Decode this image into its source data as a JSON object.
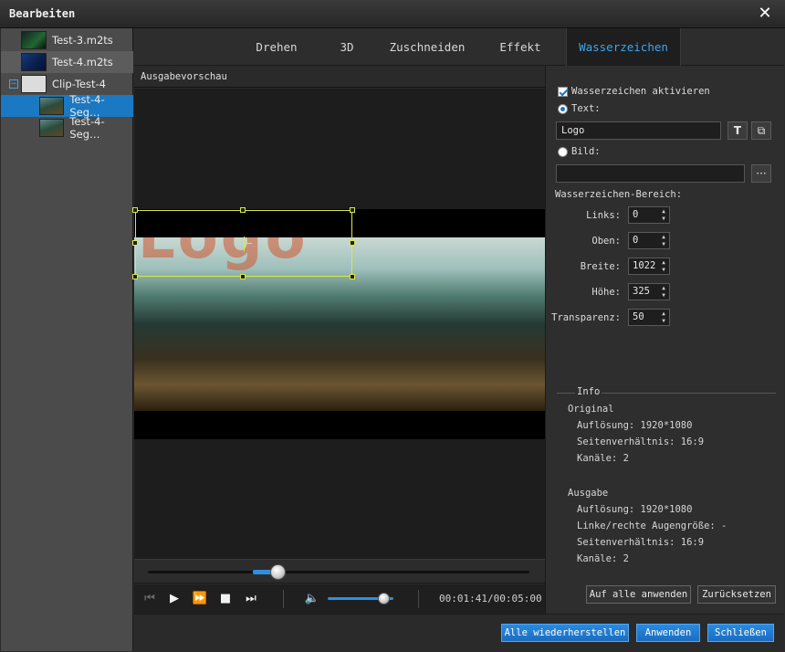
{
  "window": {
    "title": "Bearbeiten",
    "close_glyph": "✕"
  },
  "sidebar": {
    "items": [
      {
        "label": "Test-3.m2ts"
      },
      {
        "label": "Test-4.m2ts"
      },
      {
        "label": "Clip-Test-4",
        "expander": "−"
      },
      {
        "label": "Test-4-Seg…"
      },
      {
        "label": "Test-4-Seg…"
      }
    ]
  },
  "tabs": [
    {
      "label": "Drehen"
    },
    {
      "label": "3D"
    },
    {
      "label": "Zuschneiden"
    },
    {
      "label": "Effekt"
    },
    {
      "label": "Wasserzeichen",
      "active": true
    }
  ],
  "preview": {
    "label": "Ausgabevorschau",
    "watermark_text": "Logo"
  },
  "playback": {
    "seek_progress": 0.34,
    "volume_level": 0.85,
    "time": "00:01:41/00:05:00",
    "icons": {
      "prev": "skip-back-icon",
      "play": "play-icon",
      "forward": "fast-forward-icon",
      "stop": "stop-icon",
      "next": "skip-forward-icon",
      "volume": "speaker-icon"
    }
  },
  "watermark": {
    "enable_label": "Wasserzeichen aktivieren",
    "text_option_label": "Text:",
    "text_value": "Logo",
    "image_option_label": "Bild:",
    "image_value": "",
    "browse_label": "···",
    "text_icon": "T",
    "copy_icon": "⧉",
    "area_label": "Wasserzeichen-Bereich:",
    "fields": [
      {
        "label": "Links:",
        "value": "0"
      },
      {
        "label": "Oben:",
        "value": "0"
      },
      {
        "label": "Breite:",
        "value": "1022"
      },
      {
        "label": "Höhe:",
        "value": "325"
      },
      {
        "label": "Transparenz:",
        "value": "50"
      }
    ]
  },
  "info": {
    "title": "Info",
    "original_heading": "Original",
    "original": [
      "Auflösung: 1920*1080",
      "Seitenverhältnis: 16:9",
      "Kanäle: 2"
    ],
    "output_heading": "Ausgabe",
    "output": [
      "Auflösung: 1920*1080",
      "Linke/rechte Augengröße: -",
      "Seitenverhältnis: 16:9",
      "Kanäle: 2"
    ]
  },
  "buttons": {
    "apply_all": "Auf alle anwenden",
    "reset": "Zurücksetzen",
    "restore_all": "Alle wiederherstellen",
    "apply": "Anwenden",
    "close": "Schließen"
  },
  "colors": {
    "accent": "#1b78c2",
    "tab_active": "#3ba8f0",
    "watermark": "#cd5f3c",
    "selection": "#d8e84a"
  }
}
